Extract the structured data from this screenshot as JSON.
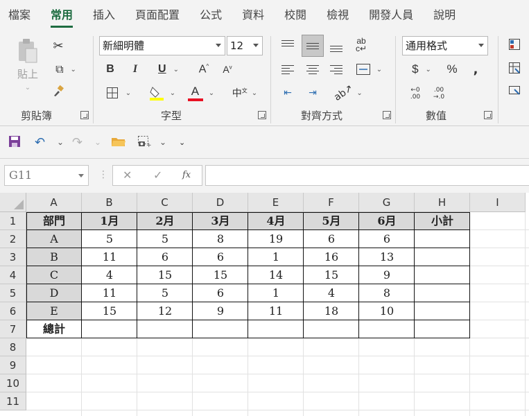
{
  "ribbon_tabs": [
    "檔案",
    "常用",
    "插入",
    "頁面配置",
    "公式",
    "資料",
    "校閱",
    "檢視",
    "開發人員",
    "說明"
  ],
  "active_tab": "常用",
  "clipboard": {
    "paste_label": "貼上",
    "group_label": "剪貼簿"
  },
  "font": {
    "name": "新細明體",
    "size": "12",
    "group_label": "字型",
    "bold": "B",
    "italic": "I",
    "underline": "U",
    "font_color_letter": "A",
    "underline_color": "#e81123",
    "fill_color": "#ffff00"
  },
  "alignment": {
    "group_label": "對齊方式"
  },
  "number": {
    "format": "通用格式",
    "group_label": "數值",
    "currency": "$",
    "percent": "%",
    "comma": ",",
    "inc_decimal": ".00",
    "dec_decimal": ".0"
  },
  "formula_bar": {
    "name_box": "G11",
    "fx": "fx",
    "cancel": "✕",
    "enter": "✓"
  },
  "columns": [
    "A",
    "B",
    "C",
    "D",
    "E",
    "F",
    "G",
    "H",
    "I"
  ],
  "rows": [
    "1",
    "2",
    "3",
    "4",
    "5",
    "6",
    "7",
    "8",
    "9",
    "10",
    "11"
  ],
  "sheet": {
    "header": [
      "部門",
      "1月",
      "2月",
      "3月",
      "4月",
      "5月",
      "6月",
      "小計"
    ],
    "data": [
      [
        "A",
        "5",
        "5",
        "8",
        "19",
        "6",
        "6",
        ""
      ],
      [
        "B",
        "11",
        "6",
        "6",
        "1",
        "16",
        "13",
        ""
      ],
      [
        "C",
        "4",
        "15",
        "15",
        "14",
        "15",
        "9",
        ""
      ],
      [
        "D",
        "11",
        "5",
        "6",
        "1",
        "4",
        "8",
        ""
      ],
      [
        "E",
        "15",
        "12",
        "9",
        "11",
        "18",
        "10",
        ""
      ]
    ],
    "total_row": [
      "總計",
      "",
      "",
      "",
      "",
      "",
      "",
      ""
    ]
  },
  "colors": {
    "accent": "#1e6c41",
    "header_fill": "#d9d9d9"
  }
}
